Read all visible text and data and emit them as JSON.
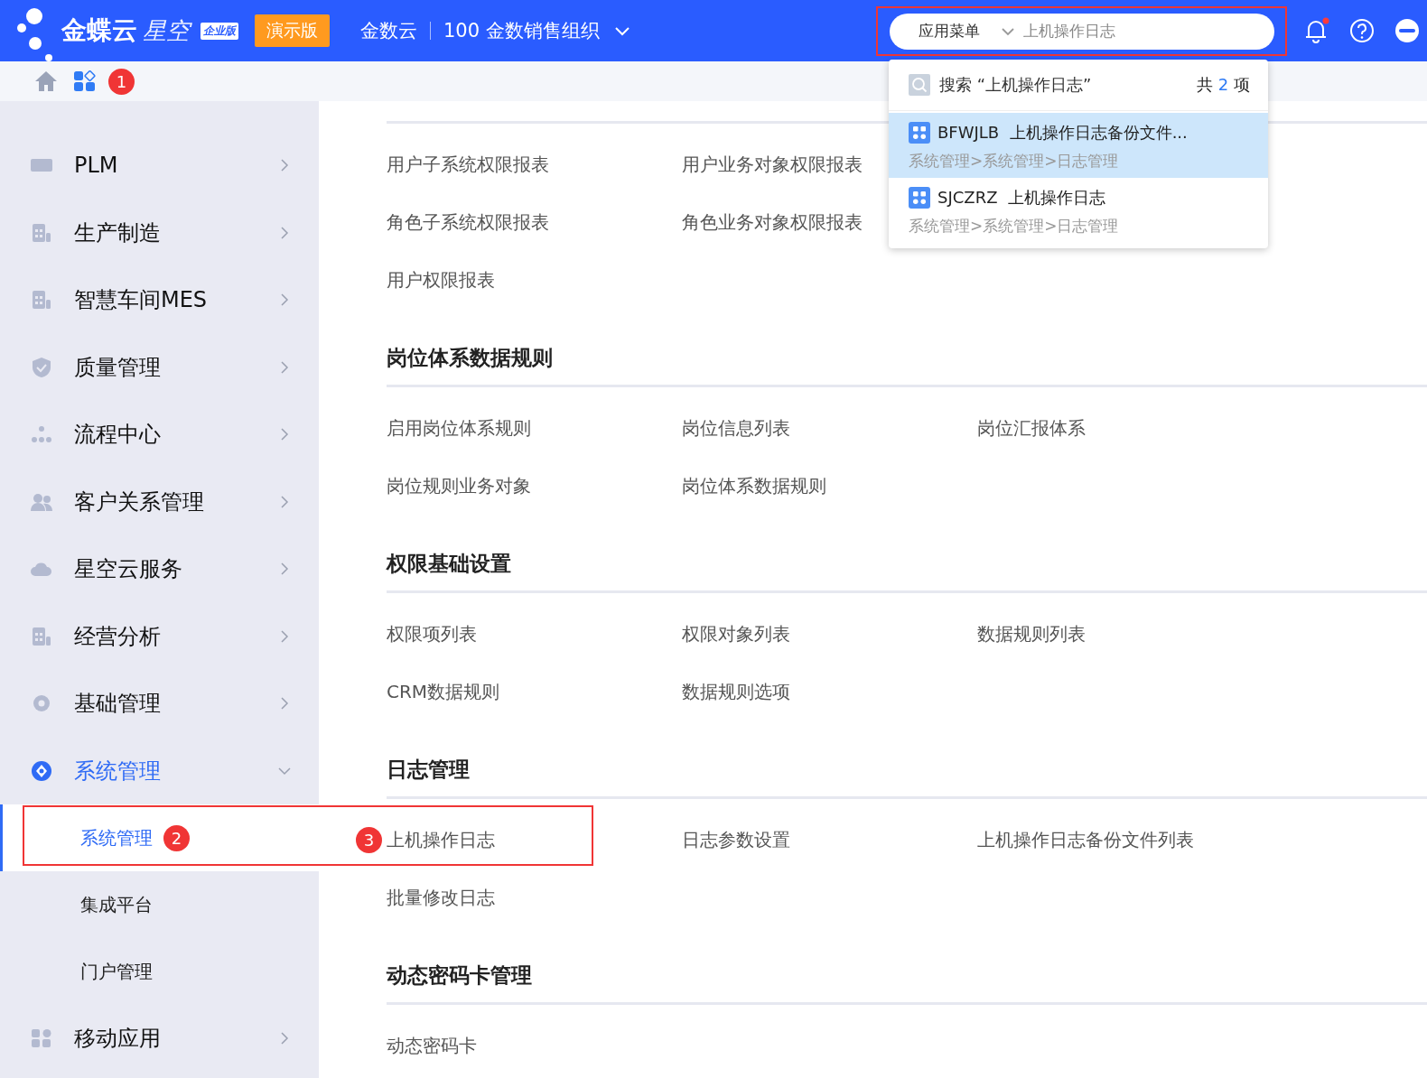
{
  "header": {
    "logo": "金蝶云",
    "logo_sub": "星空",
    "edition": "企业版",
    "demo": "演示版",
    "tenant": "金数云",
    "org": "100 金数销售组织"
  },
  "search": {
    "scope": "应用菜单",
    "value": "上机操作日志",
    "highlighted": true
  },
  "search_results": {
    "query": "搜索 “上机操作日志”",
    "total_prefix": "共",
    "total": "2",
    "total_suffix": "项",
    "items": [
      {
        "code": "BFWJLB",
        "name": "上机操作日志备份文件...",
        "path": "系统管理>系统管理>日志管理",
        "selected": true
      },
      {
        "code": "SJCZRZ",
        "name": "上机操作日志",
        "path": "系统管理>系统管理>日志管理",
        "selected": false
      }
    ]
  },
  "toolbar": {
    "badge": "1"
  },
  "sidebar": {
    "items": [
      {
        "label": "PLM",
        "expanded": false
      },
      {
        "label": "生产制造",
        "expanded": false
      },
      {
        "label": "智慧车间MES",
        "expanded": false
      },
      {
        "label": "质量管理",
        "expanded": false
      },
      {
        "label": "流程中心",
        "expanded": false
      },
      {
        "label": "客户关系管理",
        "expanded": false
      },
      {
        "label": "星空云服务",
        "expanded": false
      },
      {
        "label": "经营分析",
        "expanded": false
      },
      {
        "label": "基础管理",
        "expanded": false
      },
      {
        "label": "系统管理",
        "expanded": true,
        "children": [
          {
            "label": "系统管理",
            "selected": true,
            "badge": "2"
          },
          {
            "label": "集成平台",
            "selected": false
          },
          {
            "label": "门户管理",
            "selected": false
          }
        ]
      },
      {
        "label": "移动应用",
        "expanded": false
      }
    ]
  },
  "sections": [
    {
      "third_column_covered": true,
      "items": [
        {
          "label": "用户子系统权限报表"
        },
        {
          "label": "用户业务对象权限报表"
        },
        {
          "label": "角色子系统权限报表"
        },
        {
          "label": "角色业务对象权限报表"
        },
        {
          "label": "用户权限报表"
        }
      ]
    },
    {
      "title": "岗位体系数据规则",
      "items": [
        {
          "label": "启用岗位体系规则"
        },
        {
          "label": "岗位信息列表"
        },
        {
          "label": "岗位汇报体系"
        },
        {
          "label": "岗位规则业务对象"
        },
        {
          "label": "岗位体系数据规则"
        }
      ]
    },
    {
      "title": "权限基础设置",
      "items": [
        {
          "label": "权限项列表"
        },
        {
          "label": "权限对象列表"
        },
        {
          "label": "数据规则列表"
        },
        {
          "label": "CRM数据规则"
        },
        {
          "label": "数据规则选项"
        }
      ]
    },
    {
      "title": "日志管理",
      "items": [
        {
          "label": "上机操作日志",
          "badge": "3",
          "highlighted": true
        },
        {
          "label": "日志参数设置"
        },
        {
          "label": "上机操作日志备份文件列表"
        },
        {
          "label": "批量修改日志"
        }
      ]
    },
    {
      "title": "动态密码卡管理",
      "items": [
        {
          "label": "动态密码卡"
        }
      ]
    }
  ]
}
